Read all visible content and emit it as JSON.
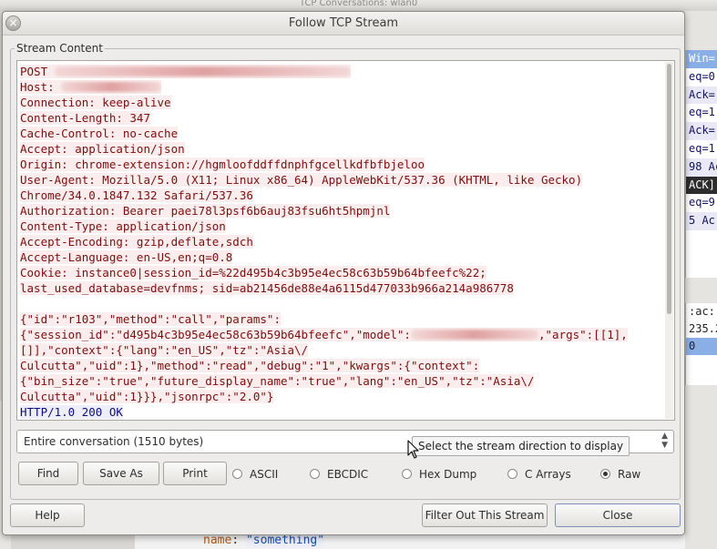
{
  "background": {
    "window_title": "TCP Conversations: wlan0",
    "right_list_rows": [
      "Win=",
      "eq=0",
      "Ack=",
      "eq=1",
      "Ack=",
      "eq=1",
      "98 Ac",
      "ACK]",
      "eq=9",
      "5 Ac"
    ],
    "right_detail_rows": [
      ":ac:",
      "235.2",
      "0"
    ],
    "code_key": "name",
    "code_colon": ": ",
    "code_value": "\"something\""
  },
  "dialog": {
    "title": "Follow TCP Stream",
    "close_glyph": "×",
    "group_label": "Stream Content",
    "stream": {
      "client_lines": [
        "POST ",
        "Host: ",
        "Connection: keep-alive",
        "Content-Length: 347",
        "Cache-Control: no-cache",
        "Accept: application/json",
        "Origin: chrome-extension://hgmloofddffdnphfgcellkdfbfbjeloo",
        "User-Agent: Mozilla/5.0 (X11; Linux x86_64) AppleWebKit/537.36 (KHTML, like Gecko)",
        "Chrome/34.0.1847.132 Safari/537.36",
        "Authorization: Bearer paei78l3psf6b6auj83fsu6ht5hpmjnl",
        "Content-Type: application/json",
        "Accept-Encoding: gzip,deflate,sdch",
        "Accept-Language: en-US,en;q=0.8",
        "Cookie: instance0|session_id=%22d495b4c3b95e4ec58c63b59b64bfeefc%22;",
        "last_used_database=devfnms; sid=ab21456de88e4a6115d477033b966a214a986778"
      ],
      "body_line1": "{\"id\":\"r103\",\"method\":\"call\",\"params\":",
      "body_line2_a": "{\"session_id\":\"d495b4c3b95e4ec58c63b59b64bfeefc\",\"model\":",
      "body_line2_b": ",\"args\":[[1],",
      "body_line3": "[]],\"context\":{\"lang\":\"en_US\",\"tz\":\"Asia\\/",
      "body_line4": "Culcutta\",\"uid\":1},\"method\":\"read\",\"debug\":\"1\",\"kwargs\":{\"context\":",
      "body_line5": "{\"bin_size\":\"true\",\"future_display_name\":\"true\",\"lang\":\"en_US\",\"tz\":\"Asia\\/",
      "body_line6": "Culcutta\",\"uid\":1}}},\"jsonrpc\":\"2.0\"}",
      "server_line": "HTTP/1.0 200 OK"
    },
    "direction_select": "Entire conversation (1510 bytes)",
    "tooltip": "Select the stream direction to display",
    "buttons": {
      "find": "Find",
      "save_as": "Save As",
      "print": "Print",
      "help": "Help",
      "filter_out": "Filter Out This Stream",
      "close": "Close"
    },
    "formats": [
      {
        "label": "ASCII",
        "selected": false
      },
      {
        "label": "EBCDIC",
        "selected": false
      },
      {
        "label": "Hex Dump",
        "selected": false
      },
      {
        "label": "C Arrays",
        "selected": false
      },
      {
        "label": "Raw",
        "selected": true
      }
    ],
    "colors": {
      "client_text": "#7b0f0f",
      "client_bg": "#fbeded",
      "server_text": "#0d0d7b",
      "server_bg": "#edeef9"
    }
  }
}
